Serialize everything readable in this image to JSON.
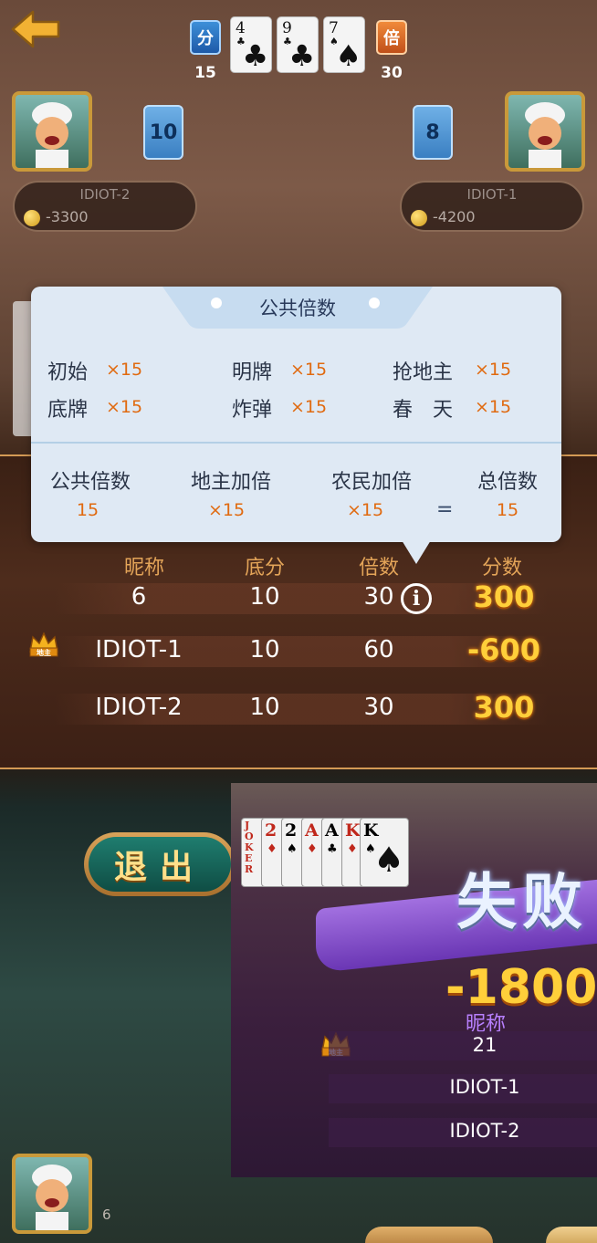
{
  "top_bar": {
    "base_badge": "分",
    "base_score": "15",
    "multiplier_badge": "倍",
    "multiplier": "30",
    "bottom_cards": [
      {
        "rank": "4",
        "suit": "♣"
      },
      {
        "rank": "9",
        "suit": "♣"
      },
      {
        "rank": "7",
        "suit": "♠"
      }
    ]
  },
  "players": {
    "left": {
      "name": "IDIOT-2",
      "balance": "-3300",
      "card_count": "10"
    },
    "right": {
      "name": "IDIOT-1",
      "balance": "-4200",
      "card_count": "8"
    },
    "self": {
      "card_count": "6"
    }
  },
  "popup": {
    "title": "公共倍数",
    "items": [
      {
        "label": "初始",
        "value": "×15"
      },
      {
        "label": "明牌",
        "value": "×15"
      },
      {
        "label": "抢地主",
        "value": "×15"
      },
      {
        "label": "底牌",
        "value": "×15"
      },
      {
        "label": "炸弹",
        "value": "×15"
      },
      {
        "label": "春　天",
        "value": "×15"
      }
    ],
    "summary": {
      "public_label": "公共倍数",
      "public_value": "15",
      "landlord_label": "地主加倍",
      "landlord_value": "×15",
      "farmer_label": "农民加倍",
      "farmer_value": "×15",
      "equals": "=",
      "total_label": "总倍数",
      "total_value": "15"
    }
  },
  "result": {
    "headers": {
      "nickname": "昵称",
      "base": "底分",
      "multiple": "倍数",
      "score": "分数"
    },
    "rows": [
      {
        "name": "6",
        "base": "10",
        "multiple": "30",
        "score": "300"
      },
      {
        "name": "IDIOT-1",
        "base": "10",
        "multiple": "60",
        "score": "-600",
        "landlord": "地主"
      },
      {
        "name": "IDIOT-2",
        "base": "10",
        "multiple": "30",
        "score": "300"
      }
    ]
  },
  "lower": {
    "exit_label": "退出",
    "lose_title": "失败",
    "lose_score": "-1800",
    "nickname_header": "昵称",
    "landlord_badge": "地主",
    "cards": [
      {
        "rank": "JOKER",
        "color": "#c0281c"
      },
      {
        "rank": "2",
        "suit": "♦",
        "color": "#c0281c"
      },
      {
        "rank": "2",
        "suit": "♠",
        "color": "#111111"
      },
      {
        "rank": "A",
        "suit": "♦",
        "color": "#c0281c"
      },
      {
        "rank": "A",
        "suit": "♣",
        "color": "#111111"
      },
      {
        "rank": "K",
        "suit": "♦",
        "color": "#c0281c"
      },
      {
        "rank": "K",
        "suit": "♠",
        "color": "#111111"
      }
    ],
    "rows": [
      "21",
      "IDIOT-1",
      "IDIOT-2"
    ]
  }
}
